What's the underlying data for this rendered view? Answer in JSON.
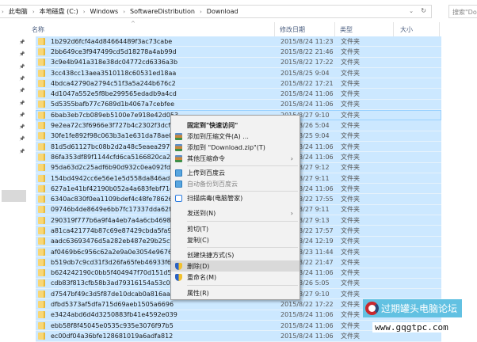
{
  "address": {
    "crumbs": [
      "此电脑",
      "本地磁盘 (C:)",
      "Windows",
      "SoftwareDistribution",
      "Download"
    ],
    "search_placeholder": "搜索\"Do"
  },
  "columns": {
    "name": "名称",
    "date": "修改日期",
    "type": "类型",
    "size": "大小"
  },
  "rows": [
    {
      "name": "1b292d6fcf4a4d84664489f3ac73cabe",
      "date": "2015/8/24 11:23",
      "type": "文件夹"
    },
    {
      "name": "2bb649ce3f947499cd5d18278a4ab99d",
      "date": "2015/8/22 21:46",
      "type": "文件夹"
    },
    {
      "name": "3c9e4b941a318e38dc04772cd6336a3b",
      "date": "2015/8/22 17:22",
      "type": "文件夹"
    },
    {
      "name": "3cc438cc13aea3510118c60531ed18aa",
      "date": "2015/8/25 9:04",
      "type": "文件夹"
    },
    {
      "name": "4bdca42790a2794c51f3a5a244b676c2",
      "date": "2015/8/22 17:21",
      "type": "文件夹"
    },
    {
      "name": "4d1047a552e5f8be299565edadb9a4cd",
      "date": "2015/8/24 11:06",
      "type": "文件夹"
    },
    {
      "name": "5d5355bafb77c7689d1b4067a7cebfee",
      "date": "2015/8/24 11:06",
      "type": "文件夹"
    },
    {
      "name": "6bab3eb7cb089eb5100e7e918e42d053",
      "date": "2015/8/27 9:10",
      "type": "文件夹"
    },
    {
      "name": "9e2ea72c3f6966e3f727b4c2302f3dcf",
      "date": "2015/8/26 5:04",
      "type": "文件夹"
    },
    {
      "name": "30fe1fe892f98c063b3a1e631da78ae0",
      "date": "2015/8/25 9:04",
      "type": "文件夹"
    },
    {
      "name": "81d5d61127bc08b2d2a48c5eaea297f8",
      "date": "2015/8/24 11:06",
      "type": "文件夹"
    },
    {
      "name": "86fa353df89f1144cfd6ca5166820ca2",
      "date": "2015/8/24 11:06",
      "type": "文件夹"
    },
    {
      "name": "95da63d2c25adf6b90d932c0ea092fde",
      "date": "2015/8/27 9:12",
      "type": "文件夹"
    },
    {
      "name": "154bd4942cc6e56e1e5d558da846aded",
      "date": "2015/8/27 9:11",
      "type": "文件夹"
    },
    {
      "name": "627a1e41bf42190b052a4a683febf71c",
      "date": "2015/8/24 11:06",
      "type": "文件夹"
    },
    {
      "name": "6340ac830f0ea1109bdef4c48fe78626",
      "date": "2015/8/22 17:55",
      "type": "文件夹"
    },
    {
      "name": "09746b4de8649e6bb7fc17337dda62f3",
      "date": "2015/8/27 9:11",
      "type": "文件夹"
    },
    {
      "name": "290319f777b6a9f4a4eb7a4a6cb4698d",
      "date": "2015/8/27 9:13",
      "type": "文件夹"
    },
    {
      "name": "a81ca421774b87c69e87429cbda5fa9e",
      "date": "2015/8/22 17:57",
      "type": "文件夹"
    },
    {
      "name": "aadc63693476d5a282eb487e29b25cf0",
      "date": "2015/8/24 12:19",
      "type": "文件夹"
    },
    {
      "name": "af0469b6c956c62a2e9a0e3054e96764",
      "date": "2015/8/23 11:44",
      "type": "文件夹"
    },
    {
      "name": "b519db7c9cd31f3d26fa65feb46933f6",
      "date": "2015/8/22 21:47",
      "type": "文件夹"
    },
    {
      "name": "b624242190c0bb5f404947f70d151d57",
      "date": "2015/8/24 11:06",
      "type": "文件夹"
    },
    {
      "name": "cdb83f813cfb58b3ad79316154a53c0a",
      "date": "2015/8/26 5:05",
      "type": "文件夹"
    },
    {
      "name": "d7547bf49c3d5f87de10dcab0a816aa1",
      "date": "2015/8/27 9:10",
      "type": "文件夹"
    },
    {
      "name": "dfbd5373af5dfa715d69aeb1505a6696",
      "date": "2015/8/22 17:22",
      "type": "文件夹"
    },
    {
      "name": "e3424abd6d4d3250883fb41e4592e039",
      "date": "2015/8/24 11:06",
      "type": "文件夹"
    },
    {
      "name": "ebb58f8f45045e0535c935e3076f97b5",
      "date": "2015/8/24 11:06",
      "type": "文件夹"
    },
    {
      "name": "ec00df04a36bfe128681019a6adfa812",
      "date": "2015/8/24 11:06",
      "type": "文件夹"
    }
  ],
  "menu": {
    "pin": "固定到\"快速访问\"",
    "add_archive": "添加到压缩文件(A) ...",
    "add_zip": "添加到 \"Download.zip\"(T)",
    "other_compress": "其他压缩命令",
    "upload_baidu": "上传到百度云",
    "auto_backup": "自动备份到百度云",
    "scan_virus": "扫描病毒(电脑管家)",
    "send_to": "发送到(N)",
    "cut": "剪切(T)",
    "copy": "复制(C)",
    "create_shortcut": "创建快捷方式(S)",
    "delete": "删除(D)",
    "rename": "重命名(M)",
    "properties": "属性(R)"
  },
  "watermark": {
    "title": "过期罐头电脑论坛",
    "url": "www.gqgtpc.com"
  },
  "colors": {
    "selection": "#cce8ff",
    "menu_highlight": "#d9d9d9"
  }
}
